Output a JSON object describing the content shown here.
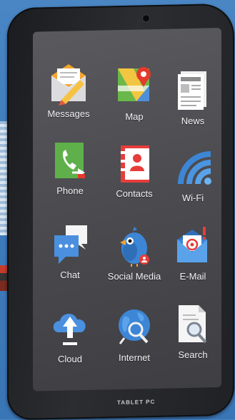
{
  "brand": "TABLET PC",
  "apps": {
    "messages": {
      "label": "Messages",
      "icon": "envelope-pencil-icon"
    },
    "map": {
      "label": "Map",
      "icon": "map-pin-icon"
    },
    "news": {
      "label": "News",
      "icon": "newspaper-icon"
    },
    "phone": {
      "label": "Phone",
      "icon": "phone-icon"
    },
    "contacts": {
      "label": "Contacts",
      "icon": "address-book-icon"
    },
    "wifi": {
      "label": "Wi-Fi",
      "icon": "wifi-icon"
    },
    "chat": {
      "label": "Chat",
      "icon": "chat-bubbles-icon"
    },
    "social": {
      "label": "Social Media",
      "icon": "bird-icon"
    },
    "email": {
      "label": "E-Mail",
      "icon": "email-icon"
    },
    "cloud": {
      "label": "Cloud",
      "icon": "cloud-upload-icon"
    },
    "internet": {
      "label": "Internet",
      "icon": "globe-search-icon"
    },
    "search": {
      "label": "Search",
      "icon": "document-search-icon"
    }
  }
}
